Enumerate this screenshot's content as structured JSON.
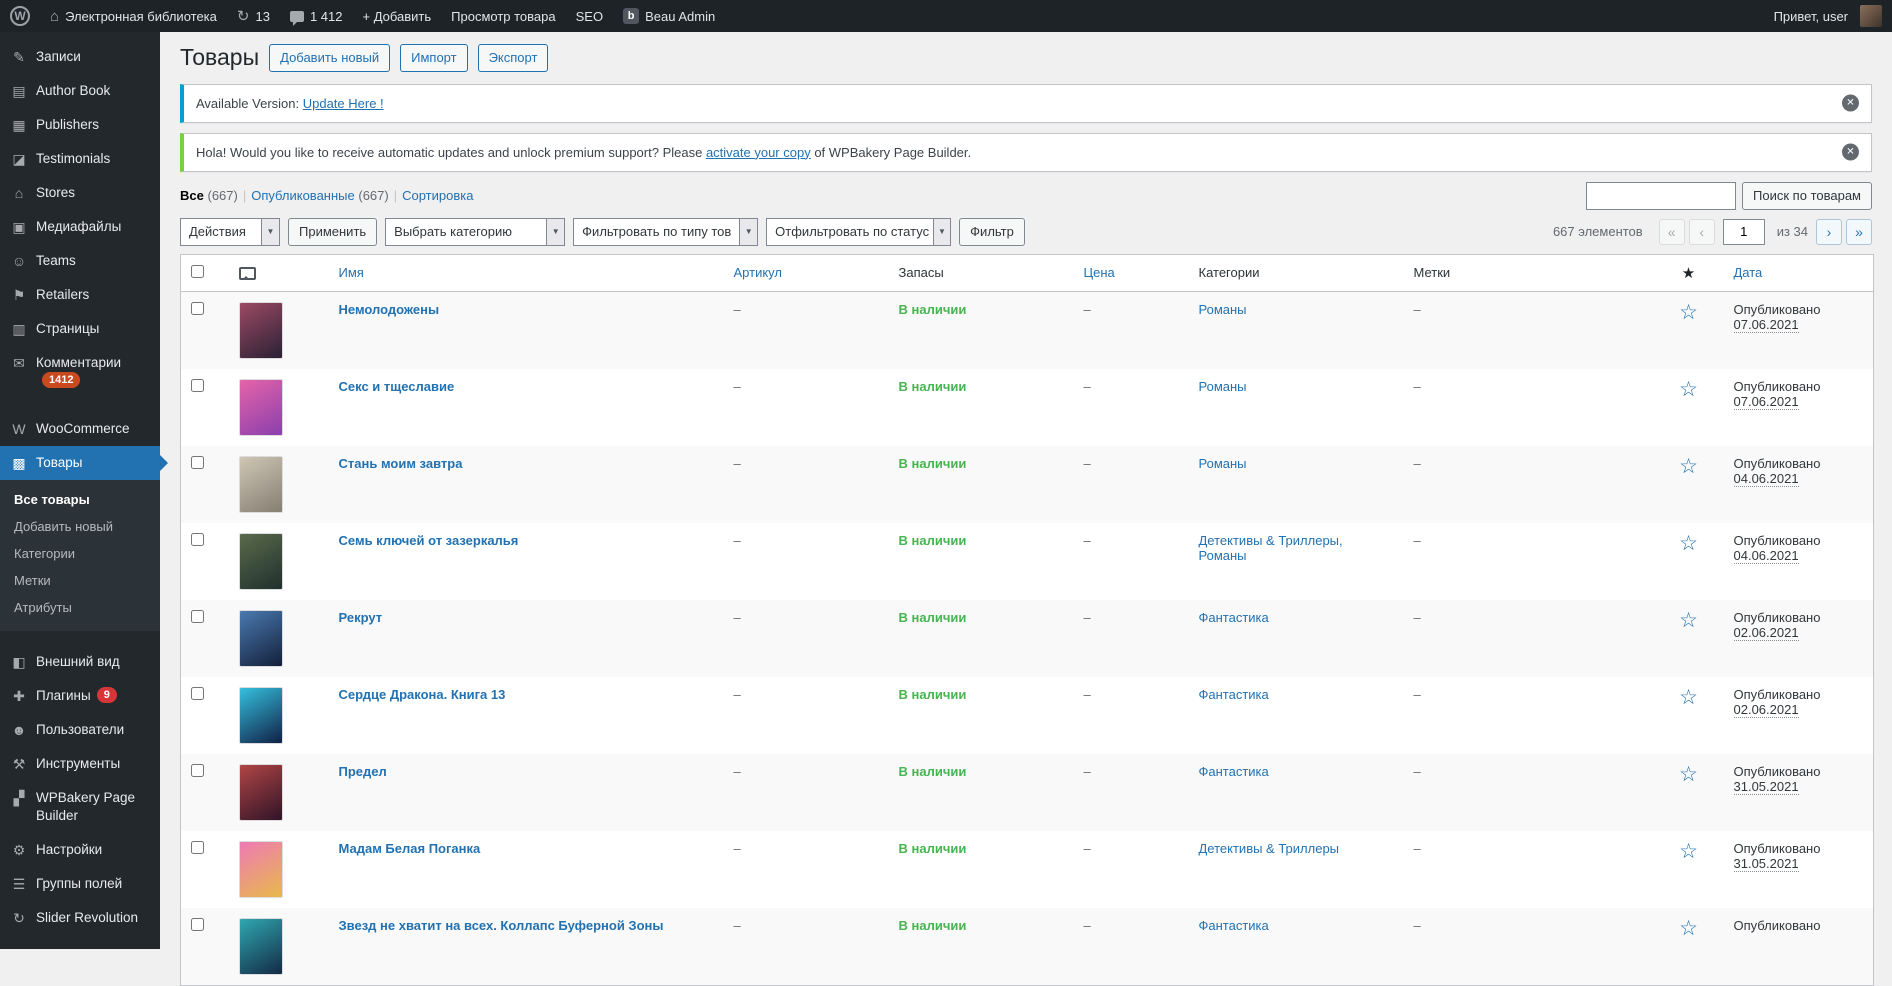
{
  "colors": {
    "accent_blue": "#2271b1",
    "menu_active_blue": "#2271b1",
    "in_stock_green": "#46b450",
    "badge_red": "#d63638",
    "notice_blue": "#00a0d2",
    "notice_green": "#7ad03a"
  },
  "admin_bar": {
    "site_name": "Электронная библиотека",
    "updates_count": "13",
    "comments_count": "1 412",
    "new_label": "+ Добавить",
    "view_product_label": "Просмотр товара",
    "seo_label": "SEO",
    "admin_theme_label": "Beau Admin",
    "howdy": "Привет, user"
  },
  "sidebar": {
    "items_top": [
      {
        "label": "Записи",
        "icon": "posts"
      },
      {
        "label": "Author Book",
        "icon": "author_book"
      },
      {
        "label": "Publishers",
        "icon": "publishers"
      },
      {
        "label": "Testimonials",
        "icon": "testimonials"
      },
      {
        "label": "Stores",
        "icon": "stores"
      },
      {
        "label": "Медиафайлы",
        "icon": "media"
      },
      {
        "label": "Teams",
        "icon": "teams"
      },
      {
        "label": "Retailers",
        "icon": "retailers"
      },
      {
        "label": "Страницы",
        "icon": "pages"
      },
      {
        "label": "Комментарии",
        "icon": "comments",
        "badge": "1412",
        "badge_color": "#ca4a1f"
      }
    ],
    "woocommerce": {
      "label": "WooCommerce",
      "icon": "woocommerce"
    },
    "products": {
      "label": "Товары",
      "icon": "products"
    },
    "submenu": [
      {
        "label": "Все товары",
        "current": true
      },
      {
        "label": "Добавить новый"
      },
      {
        "label": "Категории"
      },
      {
        "label": "Метки"
      },
      {
        "label": "Атрибуты"
      }
    ],
    "items_bottom": [
      {
        "label": "Внешний вид",
        "icon": "appearance"
      },
      {
        "label": "Плагины",
        "icon": "plugins",
        "badge": "9",
        "badge_color": "#d63638"
      },
      {
        "label": "Пользователи",
        "icon": "users"
      },
      {
        "label": "Инструменты",
        "icon": "tools"
      },
      {
        "label": "WPBakery Page Builder",
        "icon": "wpbakery"
      },
      {
        "label": "Настройки",
        "icon": "settings"
      },
      {
        "label": "Группы полей",
        "icon": "fields"
      },
      {
        "label": "Slider Revolution",
        "icon": "slider"
      }
    ]
  },
  "page": {
    "title": "Товары",
    "actions": [
      "Добавить новый",
      "Импорт",
      "Экспорт"
    ],
    "notices": [
      {
        "text": "Available Version: ",
        "link": "Update Here !",
        "text_after": ""
      },
      {
        "text": "Hola! Would you like to receive automatic updates and unlock premium support? Please ",
        "link": "activate your copy",
        "text_after": " of WPBakery Page Builder."
      }
    ],
    "views": {
      "all": "Все",
      "all_count": "(667)",
      "published": "Опубликованные",
      "published_count": "(667)",
      "sorting": "Сортировка"
    },
    "search_button": "Поиск по товарам",
    "bulk": {
      "actions": "Действия",
      "apply": "Применить",
      "category": "Выбрать категорию",
      "type": "Фильтровать по типу тов",
      "status": "Отфильтровать по статус",
      "filter": "Фильтр"
    },
    "pagination": {
      "count": "667 элементов",
      "first": "«",
      "prev": "‹",
      "page": "1",
      "of": "из 34",
      "next": "›",
      "last": "»"
    }
  },
  "table": {
    "headers": {
      "name": "Имя",
      "sku": "Артикул",
      "stock": "Запасы",
      "price": "Цена",
      "categories": "Категории",
      "tags": "Метки",
      "featured": "★",
      "date": "Дата"
    },
    "rows": [
      {
        "name": "Немолодожены",
        "sku": "–",
        "stock": "В наличии",
        "price": "–",
        "categories": "Романы",
        "tags": "–",
        "status": "Опубликовано",
        "date": "07.06.2021",
        "thumb": [
          "#9c4a63",
          "#2a2135"
        ]
      },
      {
        "name": "Секс и тщеславие",
        "sku": "–",
        "stock": "В наличии",
        "price": "–",
        "categories": "Романы",
        "tags": "–",
        "status": "Опубликовано",
        "date": "07.06.2021",
        "thumb": [
          "#e564a8",
          "#8a3fae"
        ]
      },
      {
        "name": "Стань моим завтра",
        "sku": "–",
        "stock": "В наличии",
        "price": "–",
        "categories": "Романы",
        "tags": "–",
        "status": "Опубликовано",
        "date": "04.06.2021",
        "thumb": [
          "#cfc6b5",
          "#857e72"
        ]
      },
      {
        "name": "Семь ключей от зазеркалья",
        "sku": "–",
        "stock": "В наличии",
        "price": "–",
        "categories": "Детективы & Триллеры, Романы",
        "tags": "–",
        "status": "Опубликовано",
        "date": "04.06.2021",
        "thumb": [
          "#5a6a4a",
          "#20302e"
        ]
      },
      {
        "name": "Рекрут",
        "sku": "–",
        "stock": "В наличии",
        "price": "–",
        "categories": "Фантастика",
        "tags": "–",
        "status": "Опубликовано",
        "date": "02.06.2021",
        "thumb": [
          "#4a7ab0",
          "#14203a"
        ]
      },
      {
        "name": "Сердце Дракона. Книга 13",
        "sku": "–",
        "stock": "В наличии",
        "price": "–",
        "categories": "Фантастика",
        "tags": "–",
        "status": "Опубликовано",
        "date": "02.06.2021",
        "thumb": [
          "#35c0de",
          "#102046"
        ]
      },
      {
        "name": "Предел",
        "sku": "–",
        "stock": "В наличии",
        "price": "–",
        "categories": "Фантастика",
        "tags": "–",
        "status": "Опубликовано",
        "date": "31.05.2021",
        "thumb": [
          "#b04545",
          "#301428"
        ]
      },
      {
        "name": "Мадам Белая Поганка",
        "sku": "–",
        "stock": "В наличии",
        "price": "–",
        "categories": "Детективы & Триллеры",
        "tags": "–",
        "status": "Опубликовано",
        "date": "31.05.2021",
        "thumb": [
          "#ee7ab5",
          "#e8b94a"
        ]
      },
      {
        "name": "Звезд не хватит на всех. Коллапс Буферной Зоны",
        "sku": "–",
        "stock": "В наличии",
        "price": "–",
        "categories": "Фантастика",
        "tags": "–",
        "status": "Опубликовано",
        "date": "",
        "thumb": [
          "#2fa8b0",
          "#142a46"
        ]
      }
    ]
  }
}
